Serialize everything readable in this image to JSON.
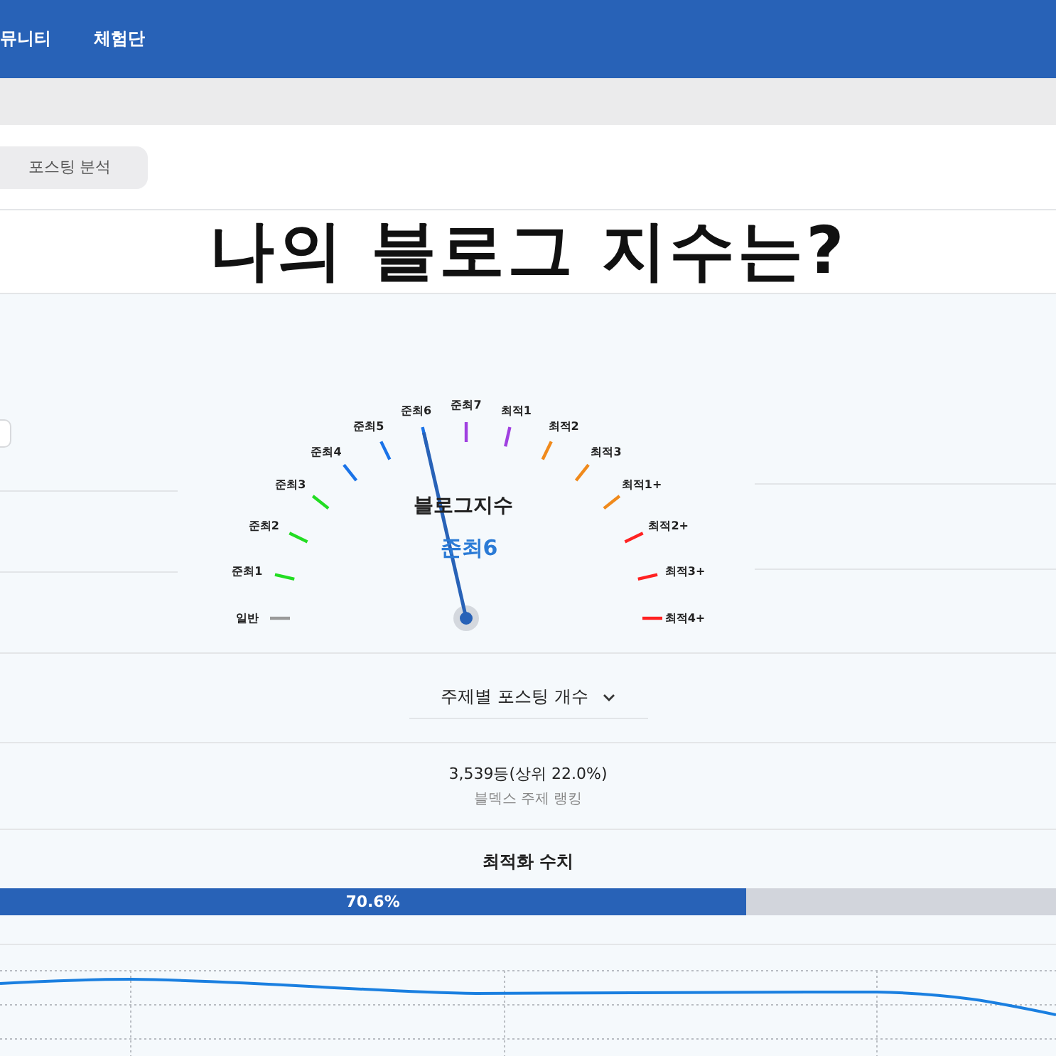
{
  "nav": {
    "items": [
      {
        "label": "뮤니티"
      },
      {
        "label": "체험단"
      }
    ]
  },
  "tabs": [
    {
      "label": "포스팅 분석",
      "selected": false
    }
  ],
  "overlay_title": "나의 블로그 지수는?",
  "gauge": {
    "title": "블로그지수",
    "value": "준최6",
    "ticks": [
      {
        "label": "일반",
        "color": "#9a9a9a",
        "selected": false
      },
      {
        "label": "준최1",
        "color": "#22dd22",
        "selected": false
      },
      {
        "label": "준최2",
        "color": "#22dd22",
        "selected": false
      },
      {
        "label": "준최3",
        "color": "#22dd22",
        "selected": false
      },
      {
        "label": "준최4",
        "color": "#1a73e8",
        "selected": false
      },
      {
        "label": "준최5",
        "color": "#1a73e8",
        "selected": false
      },
      {
        "label": "준최6",
        "color": "#1a73e8",
        "selected": true
      },
      {
        "label": "준최7",
        "color": "#a040e0",
        "selected": false
      },
      {
        "label": "최적1",
        "color": "#a040e0",
        "selected": false
      },
      {
        "label": "최적2",
        "color": "#f08a1c",
        "selected": false
      },
      {
        "label": "최적3",
        "color": "#f08a1c",
        "selected": false
      },
      {
        "label": "최적1+",
        "color": "#f08a1c",
        "selected": false
      },
      {
        "label": "최적2+",
        "color": "#ff2222",
        "selected": false
      },
      {
        "label": "최적3+",
        "color": "#ff2222",
        "selected": false
      },
      {
        "label": "최적4+",
        "color": "#ff2222",
        "selected": false
      }
    ]
  },
  "topic_dropdown": {
    "label": "주제별 포스팅 개수"
  },
  "ranking": {
    "value": "3,539등(상위 22.0%)",
    "caption": "블덱스 주제 랭킹"
  },
  "optimization": {
    "title": "최적화 수치",
    "level": 0.706,
    "reading": "70.6%"
  }
}
